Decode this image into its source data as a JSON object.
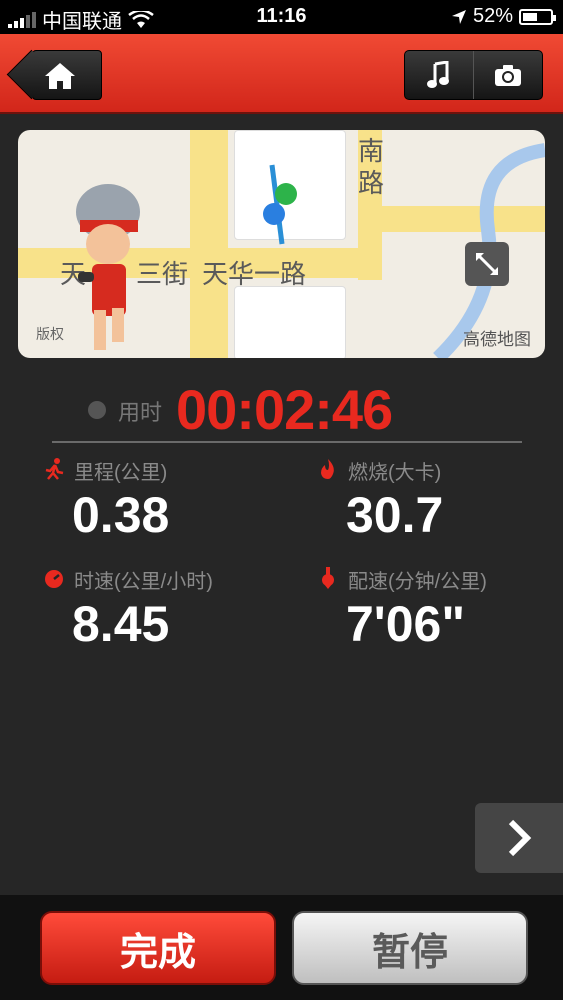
{
  "status_bar": {
    "carrier": "中国联通",
    "time": "11:16",
    "battery": "52%",
    "battery_level": 0.52
  },
  "header": {
    "home_icon": "home-icon",
    "music_icon": "music-note-icon",
    "camera_icon": "camera-icon"
  },
  "map": {
    "label_street_1": "天",
    "label_street_1b": "三街",
    "label_street_2": "天华一路",
    "label_road_vertical": "南路",
    "copyright": "版权",
    "provider": "高德地图",
    "expand_icon": "expand-icon"
  },
  "workout": {
    "time_label": "用时",
    "time_value": "00:02:46",
    "stats": [
      {
        "label": "里程(公里)",
        "value": "0.38",
        "icon": "runner-icon"
      },
      {
        "label": "燃烧(大卡)",
        "value": "30.7",
        "icon": "flame-icon"
      },
      {
        "label": "时速(公里/小时)",
        "value": "8.45",
        "icon": "speedometer-icon"
      },
      {
        "label": "配速(分钟/公里)",
        "value": "7'06\"",
        "icon": "pace-pin-icon"
      }
    ]
  },
  "actions": {
    "done_label": "完成",
    "pause_label": "暂停",
    "next_icon": "chevron-right-icon"
  },
  "colors": {
    "accent": "#e8291f",
    "header": "#e03a28",
    "background": "#262626"
  }
}
